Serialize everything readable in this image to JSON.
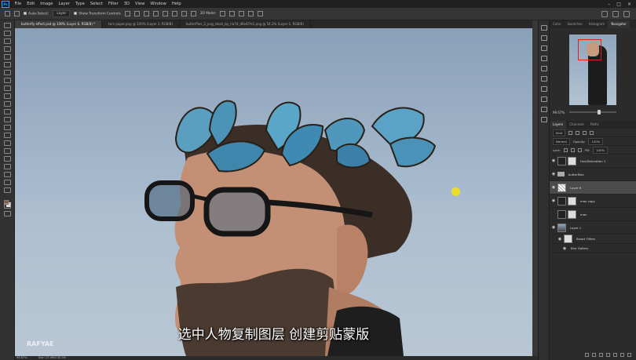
{
  "menu": [
    "File",
    "Edit",
    "Image",
    "Layer",
    "Type",
    "Select",
    "Filter",
    "3D",
    "View",
    "Window",
    "Help"
  ],
  "app_logo": "Ps",
  "options": {
    "auto_select_label": "Auto-Select:",
    "auto_select_value": "Layer",
    "transform_label": "Show Transform Controls",
    "mode_label": "3D Mode:"
  },
  "tabs": [
    "butterfly effect.psd @ 100% (Layer 6, RGB/8) *",
    "torn paper.png @ 100% (Layer 1, RGB/8)",
    "butterflies_2_png_stock_by_ria7d_d6e4l7e1.png @ 54.2% (Layer 1, RGB/8)"
  ],
  "canvas": {
    "subtitle": "选中人物复制图层 创建剪贴蒙版",
    "watermark": "RAFYAE"
  },
  "status": {
    "zoom": "99.67%",
    "doc": "Doc: 27.4M/135.5M"
  },
  "panels": {
    "nav_tabs": [
      "Color",
      "Swatches",
      "Histogram",
      "Navigator"
    ],
    "nav_active": "Navigator",
    "nav_zoom": "99.67%",
    "layer_tabs": [
      "Layers",
      "Channels",
      "Paths"
    ],
    "filter_kind": "Kind",
    "blend_mode": "Normal",
    "opacity_label": "Opacity:",
    "opacity_value": "100%",
    "lock_label": "Lock:",
    "fill_label": "Fill:",
    "fill_value": "100%"
  },
  "layers": [
    {
      "name": "Hue/Saturation 1",
      "thumb": "white",
      "selected": false,
      "indent": 0
    },
    {
      "name": "butterflies",
      "thumb": "folder",
      "selected": false,
      "indent": 0
    },
    {
      "name": "Layer 6",
      "thumb": "check",
      "selected": true,
      "indent": 0
    },
    {
      "name": "man copy",
      "thumb": "dark",
      "selected": false,
      "indent": 0
    },
    {
      "name": "man",
      "thumb": "dark",
      "selected": false,
      "indent": 0
    },
    {
      "name": "Layer 1",
      "thumb": "photo",
      "selected": false,
      "indent": 0
    },
    {
      "name": "Smart Filters",
      "thumb": "white",
      "selected": false,
      "indent": 1
    },
    {
      "name": "Blur Gallery",
      "thumb": "none",
      "selected": false,
      "indent": 2
    }
  ]
}
